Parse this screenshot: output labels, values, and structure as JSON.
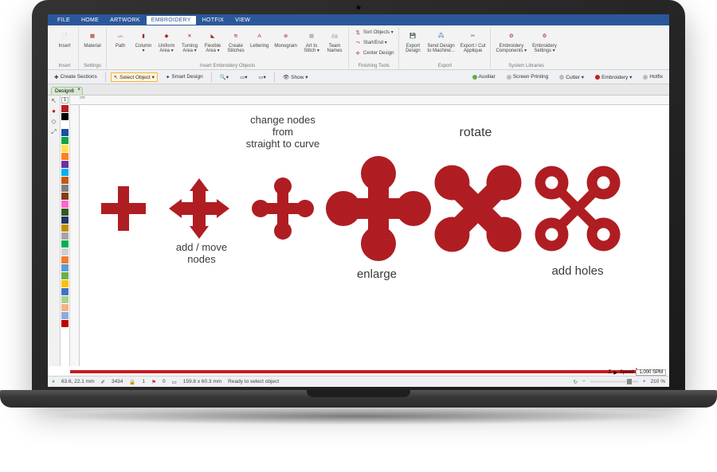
{
  "app": {
    "menu": [
      "FILE",
      "HOME",
      "ARTWORK",
      "EMBROIDERY",
      "HOTFIX",
      "VIEW"
    ],
    "active_menu": "EMBROIDERY"
  },
  "ribbon": {
    "groups": [
      {
        "label": "Insert",
        "items": [
          {
            "label": "Insert"
          }
        ]
      },
      {
        "label": "Settings",
        "items": [
          {
            "label": "Material"
          }
        ]
      },
      {
        "label": "Insert Embroidery Objects",
        "items": [
          {
            "label": "Path"
          },
          {
            "label": "Column\n▾"
          },
          {
            "label": "Uniform\nArea ▾"
          },
          {
            "label": "Turning\nArea ▾"
          },
          {
            "label": "Flexible\nArea ▾"
          },
          {
            "label": "Create\nStitches"
          },
          {
            "label": "Lettering"
          },
          {
            "label": "Monogram"
          },
          {
            "label": "Art to\nStitch ▾"
          },
          {
            "label": "Team\nNames"
          }
        ]
      },
      {
        "label": "Finishing Tools",
        "items": [
          {
            "label": "Sort Objects ▾",
            "slim": true
          },
          {
            "label": "Start/End ▾",
            "slim": true
          },
          {
            "label": "Center Design",
            "slim": true
          }
        ]
      },
      {
        "label": "Export",
        "items": [
          {
            "label": "Export\nDesign"
          },
          {
            "label": "Send Design\nto Machine..."
          },
          {
            "label": "Export / Cut\nApplique"
          }
        ]
      },
      {
        "label": "System Libraries",
        "items": [
          {
            "label": "Embroidery\nComponents ▾"
          },
          {
            "label": "Embroidery\nSettings ▾"
          }
        ]
      }
    ]
  },
  "toolbar2": {
    "left": [
      {
        "label": "Create Sections",
        "boxed": false,
        "icon": "✚"
      },
      {
        "label": "Select Object ▾",
        "boxed": true,
        "icon": "↖"
      },
      {
        "label": "Smart Design",
        "boxed": false,
        "icon": "✦"
      }
    ],
    "show_label": "Show ▾",
    "right": [
      {
        "label": "Auxiliar",
        "color": "#6aa84f"
      },
      {
        "label": "Screen Printing",
        "color": "#bbbbbb"
      },
      {
        "label": "Cutter ▾",
        "color": "#bbbbbb"
      },
      {
        "label": "Embroidery ▾",
        "color": "#c81a1f"
      },
      {
        "label": "Hotfix",
        "color": "#bbbbbb"
      }
    ]
  },
  "doc": {
    "tab": "Design8"
  },
  "palette": {
    "header": "1",
    "colors": [
      "#b61f24",
      "#000000",
      "#ffffff",
      "#1e4fa3",
      "#12a34a",
      "#ffe24a",
      "#ff7f27",
      "#7030a0",
      "#00b0f0",
      "#c55a11",
      "#7f7f7f",
      "#843c0c",
      "#ff66cc",
      "#385723",
      "#203864",
      "#bf9000",
      "#a5a5a5",
      "#00b050",
      "#d0cece",
      "#ed7d31",
      "#5b9bd5",
      "#70ad47",
      "#ffc000",
      "#4472c4",
      "#a9d18e",
      "#f4b183",
      "#8faadc",
      "#c00000"
    ]
  },
  "canvas": {
    "ruler_unit": "cm",
    "shapes": [
      {
        "id": "plus",
        "label": ""
      },
      {
        "id": "arrows",
        "label": "add / move\nnodes"
      },
      {
        "id": "arrows-round",
        "label": "change nodes\nfrom\nstraight to curve",
        "label_pos": "top"
      },
      {
        "id": "big-round",
        "label": "enlarge"
      },
      {
        "id": "xbold",
        "label": "rotate",
        "label_pos": "top"
      },
      {
        "id": "xthin",
        "label": "add holes"
      }
    ]
  },
  "status": {
    "coords": "63.6, 22.1 mm",
    "stitches": "3434",
    "layers": "1",
    "objects": "0",
    "size": "159.8 x 60.3 mm",
    "message": "Ready to select object",
    "speed_label": "Speed",
    "speed_value": "1,000 SPM",
    "zoom": "210 %"
  }
}
